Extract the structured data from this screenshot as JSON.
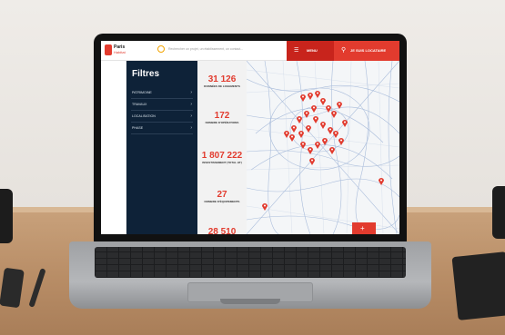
{
  "app": {
    "logo": {
      "line1": "Paris",
      "line2": "Habitat"
    },
    "search": {
      "placeholder": "Rechercher un projet, un établissement, un contact..."
    },
    "menu_button": {
      "icon": "menu-icon",
      "label": "MENU"
    },
    "account_button": {
      "icon": "user-icon",
      "label": "JE SUIS LOCATAIRE"
    },
    "accent_color": "#e23b2e",
    "sidebar_color": "#0e2238"
  },
  "sidebar": {
    "title": "Filtres",
    "items": [
      {
        "label": "PATRIMOINE"
      },
      {
        "label": "TRAVAUX"
      },
      {
        "label": "LOCALISATION"
      },
      {
        "label": "PHASE"
      }
    ]
  },
  "stats": [
    {
      "value": "31 126",
      "label": "DONNÉES DE LOGEMENTS"
    },
    {
      "value": "172",
      "label": "NOMBRE D'OPÉRATIONS"
    },
    {
      "value": "1 807 222",
      "label": "INVESTISSEMENT (TOTAL HT)"
    },
    {
      "value": "27",
      "label": "NOMBRE D'ÉQUIPEMENTS"
    },
    {
      "value": "28 510",
      "label": ""
    }
  ],
  "map": {
    "marker_color": "#e23b2e",
    "road_color": "#9db3d6",
    "fab_icon": "plus-icon"
  }
}
